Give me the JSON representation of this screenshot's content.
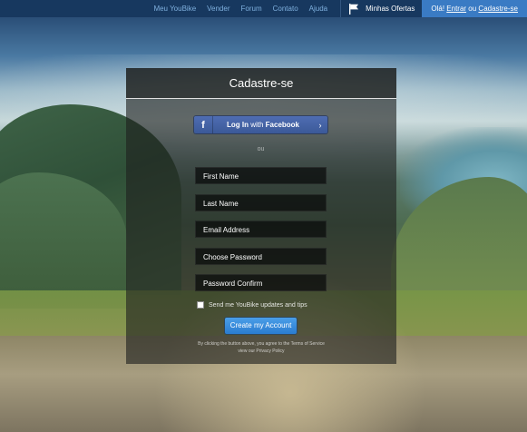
{
  "nav": {
    "links": [
      "Meu YouBike",
      "Vender",
      "Forum",
      "Contato",
      "Ajuda"
    ],
    "offers_label": "Minhas Ofertas",
    "welcome_prefix": "Olá! ",
    "login_link": "Entrar",
    "or_text": " ou ",
    "signup_link": "Cadastre-se"
  },
  "signup": {
    "title": "Cadastre-se",
    "facebook": {
      "icon": "f",
      "prefix": "Log In",
      "middle": " with ",
      "brand": "Facebook",
      "chevron": "›"
    },
    "divider": "ou",
    "fields": {
      "first_name": "First Name",
      "last_name": "Last Name",
      "email": "Email Address",
      "password": "Choose Password",
      "password_confirm": "Password Confirm"
    },
    "newsletter_label": "Send me YouBike updates and tips",
    "newsletter_checked": false,
    "submit_label": "Create my Account",
    "terms_line1": "By clicking the button above, you agree to the Terms of Service",
    "terms_line2": "view our Privacy Policy"
  },
  "colors": {
    "nav_bg": "#17385f",
    "nav_link": "#7fb0de",
    "welcome_bg": "#3a7bc4",
    "facebook_blue": "#3b5998",
    "primary_button": "#2a7cd0"
  },
  "icons": {
    "offers": "flag-icon",
    "facebook": "facebook-icon",
    "chevron": "chevron-right-icon"
  }
}
